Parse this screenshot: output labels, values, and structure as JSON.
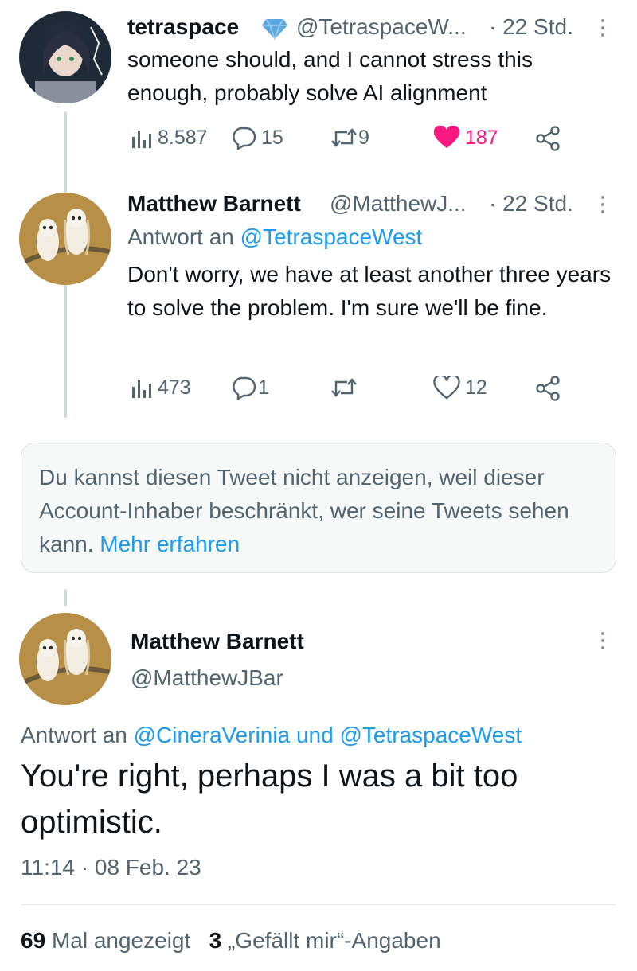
{
  "tweet1": {
    "name": "tetraspace",
    "handle": "@TetraspaceW...",
    "time": "· 22 Std.",
    "text": "someone should, and I cannot stress this enough, probably solve AI alignment",
    "views": "8.587",
    "replies": "15",
    "retweets": "9",
    "likes": "187"
  },
  "tweet2": {
    "name": "Matthew Barnett",
    "handle": "@MatthewJ...",
    "time": "· 22 Std.",
    "reply_prefix": "Antwort an",
    "reply_handle": "@TetraspaceWest",
    "text": "Don't worry, we have at least another three years to solve the problem. I'm sure we'll be fine.",
    "views": "473",
    "replies": "1",
    "retweets": "",
    "likes": "12"
  },
  "notice": {
    "text": "Du kannst diesen Tweet nicht anzeigen, weil dieser Account-Inhaber beschränkt, wer seine Tweets sehen kann.",
    "link": "Mehr erfahren"
  },
  "main_tweet": {
    "name": "Matthew Barnett",
    "handle": "@MatthewJBar",
    "reply_prefix": "Antwort an",
    "reply_handle_1": "@CineraVerinia",
    "reply_and": "und",
    "reply_handle_2": "@TetraspaceWest",
    "text": "You're right, perhaps I was a bit too optimistic.",
    "timestamp": "11:14 · 08 Feb. 23",
    "views_count": "69",
    "views_label": "Mal angezeigt",
    "likes_count": "3",
    "likes_label": "„Gefällt mir“-Angaben"
  },
  "colors": {
    "accent": "#1d9bf0",
    "like": "#f91880",
    "muted": "#536471",
    "verified": "#5ba8e0"
  },
  "icons": [
    "views-icon",
    "reply-icon",
    "retweet-icon",
    "heart-icon",
    "share-icon",
    "more-icon",
    "verified-diamond-icon"
  ]
}
